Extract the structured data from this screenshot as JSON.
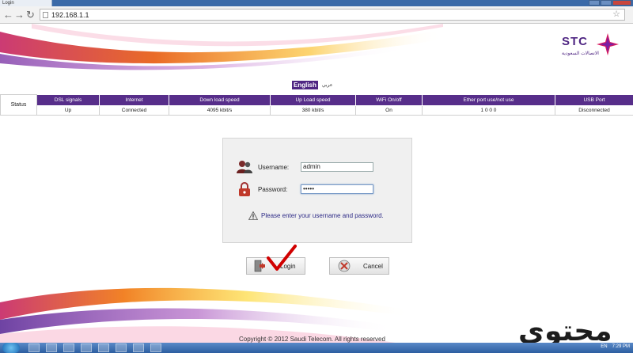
{
  "browser": {
    "tab_title": "Login",
    "url": "192.168.1.1"
  },
  "brand": {
    "logo_text": "STC",
    "logo_subtext": "الاتصالات السعودية",
    "accent": "#4f2683"
  },
  "language": {
    "english": "English",
    "arabic": "عربي"
  },
  "status_table": {
    "row_label": "Status",
    "headers": [
      "DSL signals",
      "Internet",
      "Down load speed",
      "Up Load speed",
      "WiFi On/off",
      "Ether port use/not use",
      "USB Port"
    ],
    "values": [
      "Up",
      "Connected",
      "4095 kbit/s",
      "380 kbit/s",
      "On",
      "1 0 0 0",
      "Disconnected"
    ]
  },
  "login": {
    "username_label": "Username:",
    "username_value": "admin",
    "password_label": "Password:",
    "password_value": "•••••",
    "message": "Please enter your username and password.",
    "login_button": "Login",
    "cancel_button": "Cancel"
  },
  "footer": {
    "copyright": "Copyright © 2012 Saudi Telecom. All rights reserved",
    "watermark": "محتوى"
  },
  "taskbar": {
    "lang": "EN",
    "time": "7:29 PM"
  }
}
